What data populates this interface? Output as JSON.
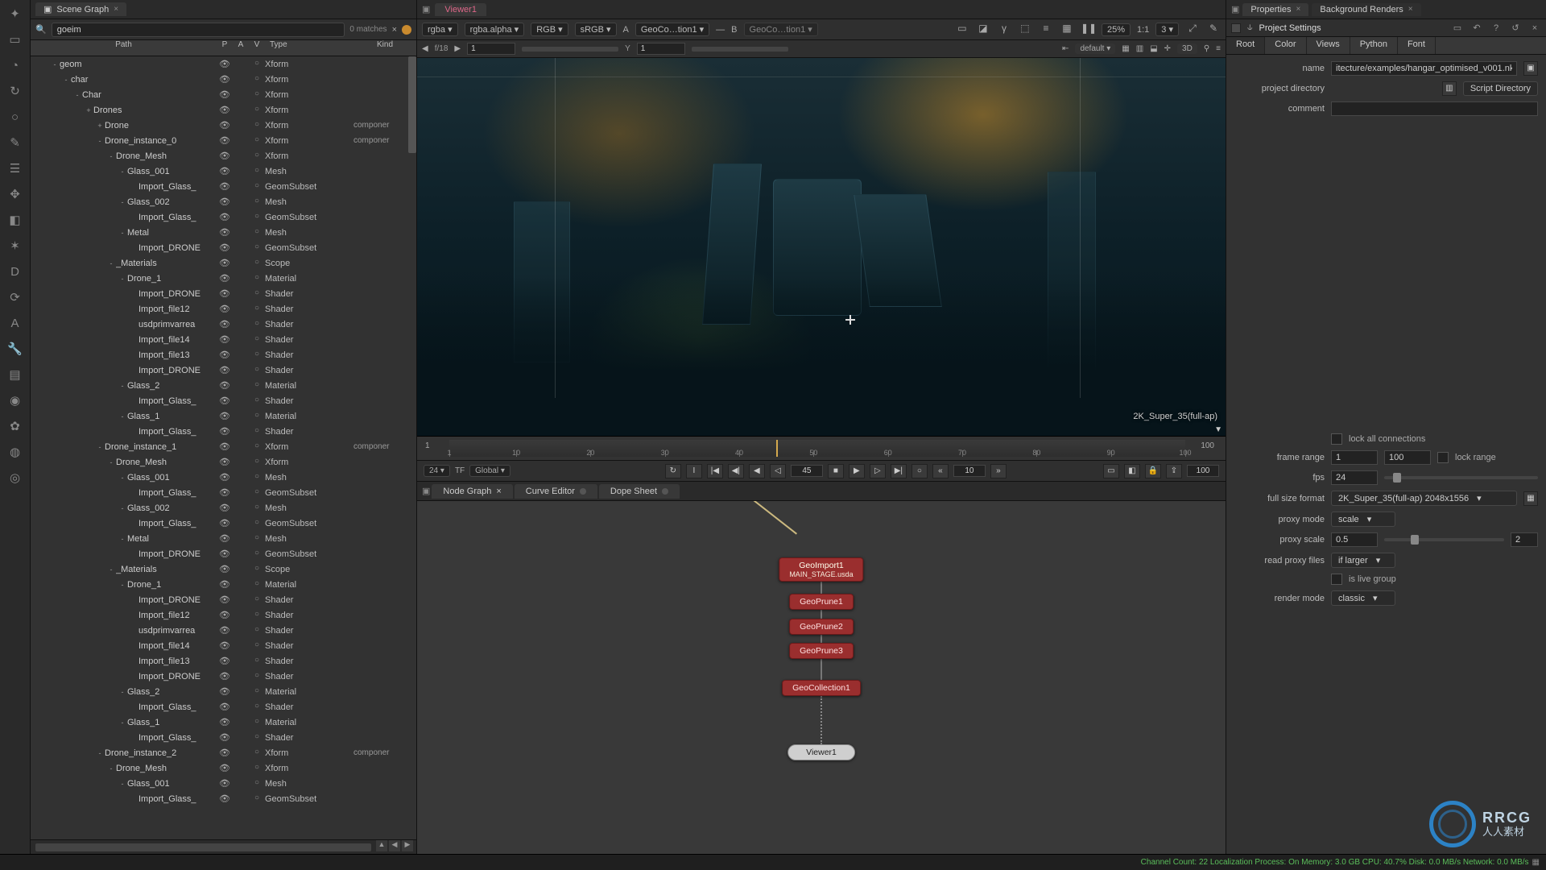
{
  "sceneGraph": {
    "tabTitle": "Scene Graph",
    "searchValue": "goeim",
    "matchText": "0 matches",
    "headers": {
      "path": "Path",
      "p": "P",
      "a": "A",
      "v": "V",
      "type": "Type",
      "kind": "Kind"
    },
    "rows": [
      {
        "d": 1,
        "tw": "-",
        "nm": "geom",
        "type": "Xform",
        "kind": ""
      },
      {
        "d": 2,
        "tw": "-",
        "nm": "char",
        "type": "Xform",
        "kind": ""
      },
      {
        "d": 3,
        "tw": "-",
        "nm": "Char",
        "type": "Xform",
        "kind": ""
      },
      {
        "d": 4,
        "tw": "+",
        "nm": "Drones",
        "type": "Xform",
        "kind": ""
      },
      {
        "d": 5,
        "tw": "+",
        "nm": "Drone",
        "type": "Xform",
        "kind": "componer"
      },
      {
        "d": 5,
        "tw": "-",
        "nm": "Drone_instance_0",
        "type": "Xform",
        "kind": "componer"
      },
      {
        "d": 6,
        "tw": "-",
        "nm": "Drone_Mesh",
        "type": "Xform",
        "kind": ""
      },
      {
        "d": 7,
        "tw": "-",
        "nm": "Glass_001",
        "type": "Mesh",
        "kind": ""
      },
      {
        "d": 8,
        "tw": "",
        "nm": "Import_Glass_",
        "type": "GeomSubset",
        "kind": ""
      },
      {
        "d": 7,
        "tw": "-",
        "nm": "Glass_002",
        "type": "Mesh",
        "kind": ""
      },
      {
        "d": 8,
        "tw": "",
        "nm": "Import_Glass_",
        "type": "GeomSubset",
        "kind": ""
      },
      {
        "d": 7,
        "tw": "-",
        "nm": "Metal",
        "type": "Mesh",
        "kind": ""
      },
      {
        "d": 8,
        "tw": "",
        "nm": "Import_DRONE",
        "type": "GeomSubset",
        "kind": ""
      },
      {
        "d": 6,
        "tw": "-",
        "nm": "_Materials",
        "type": "Scope",
        "kind": ""
      },
      {
        "d": 7,
        "tw": "-",
        "nm": "Drone_1",
        "type": "Material",
        "kind": ""
      },
      {
        "d": 8,
        "tw": "",
        "nm": "Import_DRONE",
        "type": "Shader",
        "kind": ""
      },
      {
        "d": 8,
        "tw": "",
        "nm": "Import_file12",
        "type": "Shader",
        "kind": ""
      },
      {
        "d": 8,
        "tw": "",
        "nm": "usdprimvarrea",
        "type": "Shader",
        "kind": ""
      },
      {
        "d": 8,
        "tw": "",
        "nm": "Import_file14",
        "type": "Shader",
        "kind": ""
      },
      {
        "d": 8,
        "tw": "",
        "nm": "Import_file13",
        "type": "Shader",
        "kind": ""
      },
      {
        "d": 8,
        "tw": "",
        "nm": "Import_DRONE",
        "type": "Shader",
        "kind": ""
      },
      {
        "d": 7,
        "tw": "-",
        "nm": "Glass_2",
        "type": "Material",
        "kind": ""
      },
      {
        "d": 8,
        "tw": "",
        "nm": "Import_Glass_",
        "type": "Shader",
        "kind": ""
      },
      {
        "d": 7,
        "tw": "-",
        "nm": "Glass_1",
        "type": "Material",
        "kind": ""
      },
      {
        "d": 8,
        "tw": "",
        "nm": "Import_Glass_",
        "type": "Shader",
        "kind": ""
      },
      {
        "d": 5,
        "tw": "-",
        "nm": "Drone_instance_1",
        "type": "Xform",
        "kind": "componer"
      },
      {
        "d": 6,
        "tw": "-",
        "nm": "Drone_Mesh",
        "type": "Xform",
        "kind": ""
      },
      {
        "d": 7,
        "tw": "-",
        "nm": "Glass_001",
        "type": "Mesh",
        "kind": ""
      },
      {
        "d": 8,
        "tw": "",
        "nm": "Import_Glass_",
        "type": "GeomSubset",
        "kind": ""
      },
      {
        "d": 7,
        "tw": "-",
        "nm": "Glass_002",
        "type": "Mesh",
        "kind": ""
      },
      {
        "d": 8,
        "tw": "",
        "nm": "Import_Glass_",
        "type": "GeomSubset",
        "kind": ""
      },
      {
        "d": 7,
        "tw": "-",
        "nm": "Metal",
        "type": "Mesh",
        "kind": ""
      },
      {
        "d": 8,
        "tw": "",
        "nm": "Import_DRONE",
        "type": "GeomSubset",
        "kind": ""
      },
      {
        "d": 6,
        "tw": "-",
        "nm": "_Materials",
        "type": "Scope",
        "kind": ""
      },
      {
        "d": 7,
        "tw": "-",
        "nm": "Drone_1",
        "type": "Material",
        "kind": ""
      },
      {
        "d": 8,
        "tw": "",
        "nm": "Import_DRONE",
        "type": "Shader",
        "kind": ""
      },
      {
        "d": 8,
        "tw": "",
        "nm": "Import_file12",
        "type": "Shader",
        "kind": ""
      },
      {
        "d": 8,
        "tw": "",
        "nm": "usdprimvarrea",
        "type": "Shader",
        "kind": ""
      },
      {
        "d": 8,
        "tw": "",
        "nm": "Import_file14",
        "type": "Shader",
        "kind": ""
      },
      {
        "d": 8,
        "tw": "",
        "nm": "Import_file13",
        "type": "Shader",
        "kind": ""
      },
      {
        "d": 8,
        "tw": "",
        "nm": "Import_DRONE",
        "type": "Shader",
        "kind": ""
      },
      {
        "d": 7,
        "tw": "-",
        "nm": "Glass_2",
        "type": "Material",
        "kind": ""
      },
      {
        "d": 8,
        "tw": "",
        "nm": "Import_Glass_",
        "type": "Shader",
        "kind": ""
      },
      {
        "d": 7,
        "tw": "-",
        "nm": "Glass_1",
        "type": "Material",
        "kind": ""
      },
      {
        "d": 8,
        "tw": "",
        "nm": "Import_Glass_",
        "type": "Shader",
        "kind": ""
      },
      {
        "d": 5,
        "tw": "-",
        "nm": "Drone_instance_2",
        "type": "Xform",
        "kind": "componer"
      },
      {
        "d": 6,
        "tw": "-",
        "nm": "Drone_Mesh",
        "type": "Xform",
        "kind": ""
      },
      {
        "d": 7,
        "tw": "-",
        "nm": "Glass_001",
        "type": "Mesh",
        "kind": ""
      },
      {
        "d": 8,
        "tw": "",
        "nm": "Import_Glass_",
        "type": "GeomSubset",
        "kind": ""
      }
    ]
  },
  "viewer": {
    "tabTitle": "Viewer1",
    "channels": "rgba",
    "alpha": "rgba.alpha",
    "layer": "RGB",
    "lut": "sRGB",
    "inputA_label": "A",
    "inputA": "GeoCo…tion1",
    "inputB_label": "B",
    "inputB": "GeoCo…tion1",
    "zoom": "25%",
    "ratio": "1:1",
    "fps_label": "f/18",
    "one": "1",
    "y_label": "Y",
    "y_val": "1",
    "overlay": "default",
    "mode3d": "3D",
    "formatLabel": "2K_Super_35(full-ap)"
  },
  "timeline": {
    "start": "1",
    "end": "100",
    "ticks": [
      1,
      10,
      20,
      30,
      40,
      50,
      60,
      70,
      80,
      90,
      100
    ],
    "playhead": 45,
    "fps": "24",
    "fpsTri": "▾",
    "tf": "TF",
    "scope": "Global",
    "curFrame": "45",
    "step": "10",
    "endFrame": "100"
  },
  "bottomTabs": {
    "t1": "Node Graph",
    "t2": "Curve Editor",
    "t3": "Dope Sheet"
  },
  "nodes": {
    "import": "GeoImport1",
    "importSub": "MAIN_STAGE.usda",
    "p1": "GeoPrune1",
    "p2": "GeoPrune2",
    "p3": "GeoPrune3",
    "coll": "GeoCollection1",
    "viewer": "Viewer1"
  },
  "propsPanel": {
    "tab1": "Properties",
    "tab2": "Background Renders",
    "sectionTitle": "Project Settings",
    "subtabs": [
      "Root",
      "Color",
      "Views",
      "Python",
      "Font"
    ],
    "name_label": "name",
    "name_val": "itecture/examples/hangar_optimised_v001.nk",
    "projdir_label": "project directory",
    "projdir_btn": "Script Directory",
    "comment_label": "comment",
    "lockconn": "lock all connections",
    "framerange_label": "frame range",
    "fr_a": "1",
    "fr_b": "100",
    "lockrange": "lock range",
    "fps_label": "fps",
    "fps_val": "24",
    "fullfmt_label": "full size format",
    "fullfmt_val": "2K_Super_35(full-ap) 2048x1556",
    "proxymode_label": "proxy mode",
    "proxymode_val": "scale",
    "proxyscale_label": "proxy scale",
    "proxyscale_val": "0.5",
    "proxyscale_r": "2",
    "readproxy_label": "read proxy files",
    "readproxy_val": "if larger",
    "livegroup": "is live group",
    "rendermode_label": "render mode",
    "rendermode_val": "classic"
  },
  "status": {
    "text": "Channel Count: 22 Localization Process: On Memory: 3.0 GB CPU: 40.7% Disk: 0.0 MB/s Network: 0.0 MB/s"
  },
  "watermark": {
    "brand": "RRCG",
    "sub": "人人素材"
  },
  "toolstrip_count": "3"
}
